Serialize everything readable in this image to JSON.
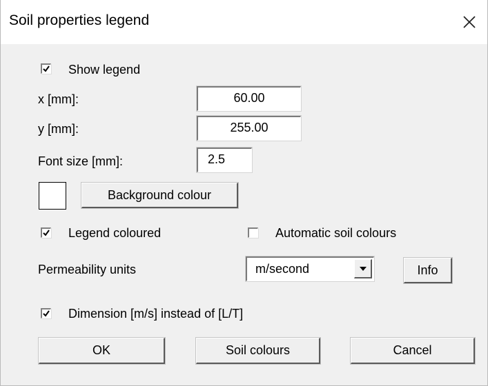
{
  "window": {
    "title": "Soil properties legend",
    "close_icon": "close-icon"
  },
  "show_legend": {
    "label": "Show legend",
    "checked": true
  },
  "x_field": {
    "label": "x [mm]:",
    "value": "60.00"
  },
  "y_field": {
    "label": "y [mm]:",
    "value": "255.00"
  },
  "font_size_field": {
    "label": "Font size [mm]:",
    "value": "2.5"
  },
  "background": {
    "button_label": "Background colour",
    "swatch_color": "#ffffff"
  },
  "legend_coloured": {
    "label": "Legend coloured",
    "checked": true
  },
  "automatic_soil_colours": {
    "label": "Automatic soil colours",
    "checked": false
  },
  "permeability": {
    "label": "Permeability units",
    "selected": "m/second",
    "info_label": "Info"
  },
  "dimension": {
    "label": "Dimension [m/s] instead of [L/T]",
    "checked": true
  },
  "footer": {
    "ok_label": "OK",
    "soil_colours_label": "Soil colours",
    "cancel_label": "Cancel"
  }
}
